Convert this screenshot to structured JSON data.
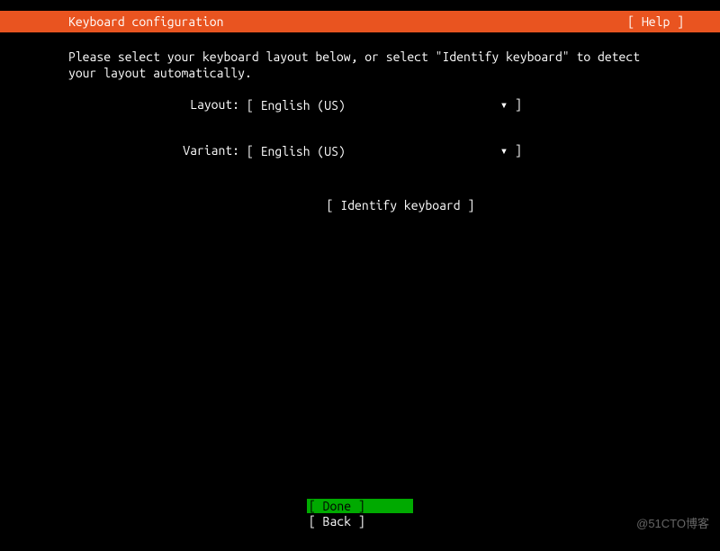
{
  "header": {
    "title": "Keyboard configuration",
    "help": "[ Help ]"
  },
  "instruction": "Please select your keyboard layout below, or select \"Identify keyboard\" to detect your layout automatically.",
  "form": {
    "layout": {
      "label": "Layout:",
      "value": "[ English (US)",
      "arrow": "▾ ]"
    },
    "variant": {
      "label": "Variant:",
      "value": "[ English (US)",
      "arrow": "▾ ]"
    },
    "identify": "[ Identify keyboard ]"
  },
  "footer": {
    "done": "[ Done       ]",
    "back": "[ Back       ]"
  },
  "watermark": "@51CTO博客"
}
